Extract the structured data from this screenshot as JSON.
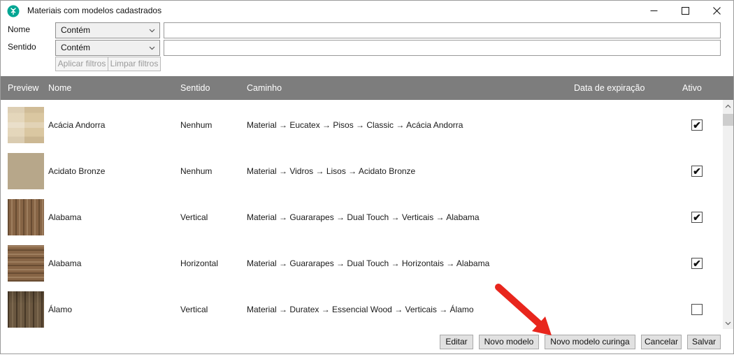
{
  "window": {
    "title": "Materiais com modelos cadastrados"
  },
  "filters": {
    "nome_label": "Nome",
    "sentido_label": "Sentido",
    "nome_operator": "Contém",
    "sentido_operator": "Contém",
    "nome_value": "",
    "sentido_value": "",
    "apply_label": "Aplicar filtros",
    "clear_label": "Limpar filtros"
  },
  "table": {
    "columns": [
      "Preview",
      "Nome",
      "Sentido",
      "Caminho",
      "Data de expiração",
      "Ativo"
    ],
    "rows": [
      {
        "name": "Acácia Andorra",
        "sentido": "Nenhum",
        "caminho": "Material → Eucatex → Pisos → Classic → Acácia Andorra",
        "data_expiracao": "",
        "ativo": true,
        "ativo_glyph": "✔",
        "preview": "travertine-beige"
      },
      {
        "name": "Acidato Bronze",
        "sentido": "Nenhum",
        "caminho": "Material → Vidros → Lisos → Acidato Bronze",
        "data_expiracao": "",
        "ativo": true,
        "ativo_glyph": "✔",
        "preview": "flat-tan"
      },
      {
        "name": "Alabama",
        "sentido": "Vertical",
        "caminho": "Material → Guararapes → Dual Touch → Verticais → Alabama",
        "data_expiracao": "",
        "ativo": true,
        "ativo_glyph": "✔",
        "preview": "wood-vertical"
      },
      {
        "name": "Alabama",
        "sentido": "Horizontal",
        "caminho": "Material → Guararapes → Dual Touch → Horizontais → Alabama",
        "data_expiracao": "",
        "ativo": true,
        "ativo_glyph": "✔",
        "preview": "wood-horizontal"
      },
      {
        "name": "Álamo",
        "sentido": "Vertical",
        "caminho": "Material → Duratex → Essencial Wood → Verticais → Álamo",
        "data_expiracao": "",
        "ativo": false,
        "ativo_glyph": "",
        "preview": "wood-dark-vertical"
      }
    ]
  },
  "footer": {
    "editar": "Editar",
    "novo_modelo": "Novo modelo",
    "novo_modelo_curinga": "Novo modelo curinga",
    "cancelar": "Cancelar",
    "salvar": "Salvar"
  },
  "annotation": {
    "arrow_color": "#e8261d"
  },
  "colors": {
    "grid_header_bg": "#7d7d7d",
    "titlebar_icon": "#00a693",
    "scroll_thumb": "#cdcdcd",
    "button_bg": "#e1e1e1"
  }
}
